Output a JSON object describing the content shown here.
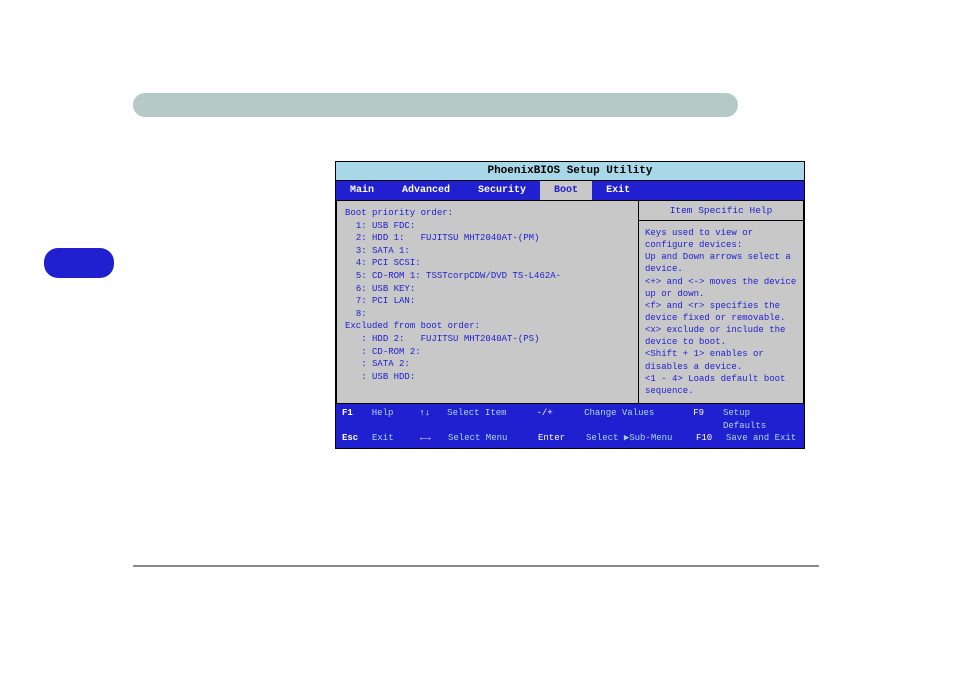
{
  "bios": {
    "title": "PhoenixBIOS Setup Utility",
    "tabs": [
      {
        "label": "Main",
        "active": false
      },
      {
        "label": "Advanced",
        "active": false
      },
      {
        "label": "Security",
        "active": false
      },
      {
        "label": "Boot",
        "active": true
      },
      {
        "label": "Exit",
        "active": false
      }
    ],
    "boot_heading": "Boot priority order:",
    "boot_items": [
      {
        "num": "1:",
        "label": "USB FDC:",
        "selected": true
      },
      {
        "num": "2:",
        "label": "HDD 1:   FUJITSU MHT2040AT-(PM)",
        "selected": false
      },
      {
        "num": "3:",
        "label": "SATA 1:",
        "selected": false
      },
      {
        "num": "4:",
        "label": "PCI SCSI:",
        "selected": false
      },
      {
        "num": "5:",
        "label": "CD-ROM 1: TSSTcorpCDW/DVD TS-L462A-",
        "selected": false
      },
      {
        "num": "6:",
        "label": "USB KEY:",
        "selected": false
      },
      {
        "num": "7:",
        "label": "PCI LAN:",
        "selected": false
      },
      {
        "num": "8:",
        "label": "",
        "selected": false
      }
    ],
    "excluded_heading": "Excluded from boot order:",
    "excluded_items": [
      {
        "num": ":",
        "label": "HDD 2:   FUJITSU MHT2040AT-(PS)"
      },
      {
        "num": ":",
        "label": "CD-ROM 2:"
      },
      {
        "num": ":",
        "label": "SATA 2:"
      },
      {
        "num": ":",
        "label": "USB HDD:"
      }
    ],
    "help_title": "Item Specific Help",
    "help_body": "Keys used to view or configure devices:\nUp and Down arrows select a device.\n<+> and <-> moves the device up or down.\n<f> and <r> specifies the device fixed or removable.\n<x> exclude or include the device to boot.\n<Shift + 1> enables or disables a device.\n<1 - 4> Loads default boot sequence.",
    "footer": {
      "row1": {
        "k1": "F1",
        "l1": "Help",
        "arrows": "↑↓",
        "l2": "Select Item",
        "k2": "-/+",
        "l3": "Change Values",
        "k3": "F9",
        "l4": "Setup Defaults"
      },
      "row2": {
        "k1": "Esc",
        "l1": "Exit",
        "arrows": "←→",
        "l2": "Select Menu",
        "k2": "Enter",
        "l3_pre": "Select ",
        "l3_post": "Sub-Menu",
        "k3": "F10",
        "l4": "Save and Exit"
      }
    }
  }
}
